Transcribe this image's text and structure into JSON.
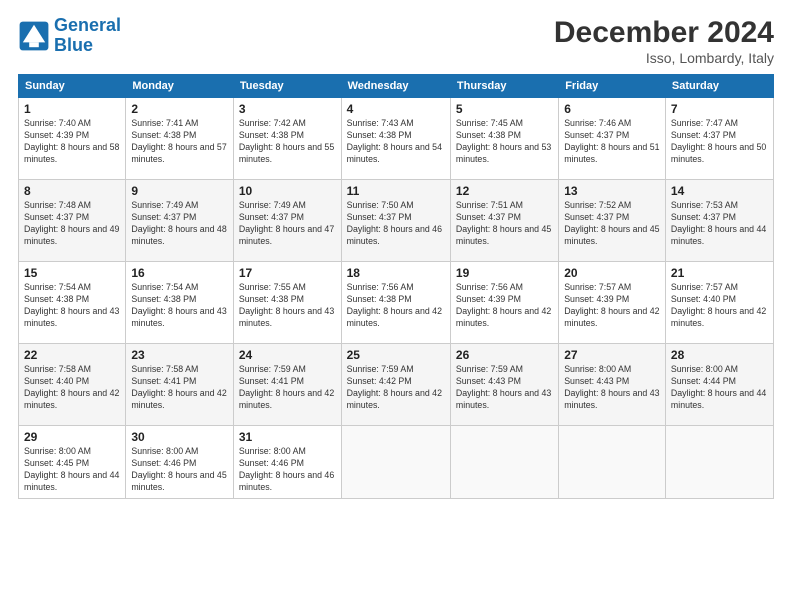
{
  "header": {
    "logo_line1": "General",
    "logo_line2": "Blue",
    "month_title": "December 2024",
    "location": "Isso, Lombardy, Italy"
  },
  "weekdays": [
    "Sunday",
    "Monday",
    "Tuesday",
    "Wednesday",
    "Thursday",
    "Friday",
    "Saturday"
  ],
  "weeks": [
    [
      {
        "day": "1",
        "sunrise": "Sunrise: 7:40 AM",
        "sunset": "Sunset: 4:39 PM",
        "daylight": "Daylight: 8 hours and 58 minutes."
      },
      {
        "day": "2",
        "sunrise": "Sunrise: 7:41 AM",
        "sunset": "Sunset: 4:38 PM",
        "daylight": "Daylight: 8 hours and 57 minutes."
      },
      {
        "day": "3",
        "sunrise": "Sunrise: 7:42 AM",
        "sunset": "Sunset: 4:38 PM",
        "daylight": "Daylight: 8 hours and 55 minutes."
      },
      {
        "day": "4",
        "sunrise": "Sunrise: 7:43 AM",
        "sunset": "Sunset: 4:38 PM",
        "daylight": "Daylight: 8 hours and 54 minutes."
      },
      {
        "day": "5",
        "sunrise": "Sunrise: 7:45 AM",
        "sunset": "Sunset: 4:38 PM",
        "daylight": "Daylight: 8 hours and 53 minutes."
      },
      {
        "day": "6",
        "sunrise": "Sunrise: 7:46 AM",
        "sunset": "Sunset: 4:37 PM",
        "daylight": "Daylight: 8 hours and 51 minutes."
      },
      {
        "day": "7",
        "sunrise": "Sunrise: 7:47 AM",
        "sunset": "Sunset: 4:37 PM",
        "daylight": "Daylight: 8 hours and 50 minutes."
      }
    ],
    [
      {
        "day": "8",
        "sunrise": "Sunrise: 7:48 AM",
        "sunset": "Sunset: 4:37 PM",
        "daylight": "Daylight: 8 hours and 49 minutes."
      },
      {
        "day": "9",
        "sunrise": "Sunrise: 7:49 AM",
        "sunset": "Sunset: 4:37 PM",
        "daylight": "Daylight: 8 hours and 48 minutes."
      },
      {
        "day": "10",
        "sunrise": "Sunrise: 7:49 AM",
        "sunset": "Sunset: 4:37 PM",
        "daylight": "Daylight: 8 hours and 47 minutes."
      },
      {
        "day": "11",
        "sunrise": "Sunrise: 7:50 AM",
        "sunset": "Sunset: 4:37 PM",
        "daylight": "Daylight: 8 hours and 46 minutes."
      },
      {
        "day": "12",
        "sunrise": "Sunrise: 7:51 AM",
        "sunset": "Sunset: 4:37 PM",
        "daylight": "Daylight: 8 hours and 45 minutes."
      },
      {
        "day": "13",
        "sunrise": "Sunrise: 7:52 AM",
        "sunset": "Sunset: 4:37 PM",
        "daylight": "Daylight: 8 hours and 45 minutes."
      },
      {
        "day": "14",
        "sunrise": "Sunrise: 7:53 AM",
        "sunset": "Sunset: 4:37 PM",
        "daylight": "Daylight: 8 hours and 44 minutes."
      }
    ],
    [
      {
        "day": "15",
        "sunrise": "Sunrise: 7:54 AM",
        "sunset": "Sunset: 4:38 PM",
        "daylight": "Daylight: 8 hours and 43 minutes."
      },
      {
        "day": "16",
        "sunrise": "Sunrise: 7:54 AM",
        "sunset": "Sunset: 4:38 PM",
        "daylight": "Daylight: 8 hours and 43 minutes."
      },
      {
        "day": "17",
        "sunrise": "Sunrise: 7:55 AM",
        "sunset": "Sunset: 4:38 PM",
        "daylight": "Daylight: 8 hours and 43 minutes."
      },
      {
        "day": "18",
        "sunrise": "Sunrise: 7:56 AM",
        "sunset": "Sunset: 4:38 PM",
        "daylight": "Daylight: 8 hours and 42 minutes."
      },
      {
        "day": "19",
        "sunrise": "Sunrise: 7:56 AM",
        "sunset": "Sunset: 4:39 PM",
        "daylight": "Daylight: 8 hours and 42 minutes."
      },
      {
        "day": "20",
        "sunrise": "Sunrise: 7:57 AM",
        "sunset": "Sunset: 4:39 PM",
        "daylight": "Daylight: 8 hours and 42 minutes."
      },
      {
        "day": "21",
        "sunrise": "Sunrise: 7:57 AM",
        "sunset": "Sunset: 4:40 PM",
        "daylight": "Daylight: 8 hours and 42 minutes."
      }
    ],
    [
      {
        "day": "22",
        "sunrise": "Sunrise: 7:58 AM",
        "sunset": "Sunset: 4:40 PM",
        "daylight": "Daylight: 8 hours and 42 minutes."
      },
      {
        "day": "23",
        "sunrise": "Sunrise: 7:58 AM",
        "sunset": "Sunset: 4:41 PM",
        "daylight": "Daylight: 8 hours and 42 minutes."
      },
      {
        "day": "24",
        "sunrise": "Sunrise: 7:59 AM",
        "sunset": "Sunset: 4:41 PM",
        "daylight": "Daylight: 8 hours and 42 minutes."
      },
      {
        "day": "25",
        "sunrise": "Sunrise: 7:59 AM",
        "sunset": "Sunset: 4:42 PM",
        "daylight": "Daylight: 8 hours and 42 minutes."
      },
      {
        "day": "26",
        "sunrise": "Sunrise: 7:59 AM",
        "sunset": "Sunset: 4:43 PM",
        "daylight": "Daylight: 8 hours and 43 minutes."
      },
      {
        "day": "27",
        "sunrise": "Sunrise: 8:00 AM",
        "sunset": "Sunset: 4:43 PM",
        "daylight": "Daylight: 8 hours and 43 minutes."
      },
      {
        "day": "28",
        "sunrise": "Sunrise: 8:00 AM",
        "sunset": "Sunset: 4:44 PM",
        "daylight": "Daylight: 8 hours and 44 minutes."
      }
    ],
    [
      {
        "day": "29",
        "sunrise": "Sunrise: 8:00 AM",
        "sunset": "Sunset: 4:45 PM",
        "daylight": "Daylight: 8 hours and 44 minutes."
      },
      {
        "day": "30",
        "sunrise": "Sunrise: 8:00 AM",
        "sunset": "Sunset: 4:46 PM",
        "daylight": "Daylight: 8 hours and 45 minutes."
      },
      {
        "day": "31",
        "sunrise": "Sunrise: 8:00 AM",
        "sunset": "Sunset: 4:46 PM",
        "daylight": "Daylight: 8 hours and 46 minutes."
      },
      null,
      null,
      null,
      null
    ]
  ]
}
